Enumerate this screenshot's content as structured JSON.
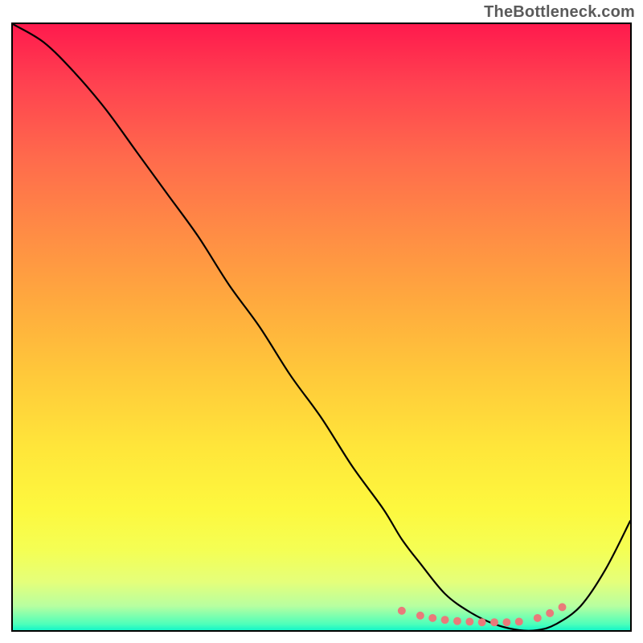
{
  "watermark": "TheBottleneck.com",
  "chart_data": {
    "type": "line",
    "title": "",
    "xlabel": "",
    "ylabel": "",
    "xlim": [
      0,
      100
    ],
    "ylim": [
      0,
      100
    ],
    "gradient_stops": [
      {
        "offset": 0,
        "color": "#ff1a4d"
      },
      {
        "offset": 10,
        "color": "#ff4250"
      },
      {
        "offset": 22,
        "color": "#ff6a4c"
      },
      {
        "offset": 34,
        "color": "#ff8b45"
      },
      {
        "offset": 46,
        "color": "#ffaa3e"
      },
      {
        "offset": 58,
        "color": "#ffc93a"
      },
      {
        "offset": 70,
        "color": "#ffe63a"
      },
      {
        "offset": 80,
        "color": "#fdf83e"
      },
      {
        "offset": 87,
        "color": "#f4ff55"
      },
      {
        "offset": 92,
        "color": "#e5ff7a"
      },
      {
        "offset": 96,
        "color": "#b8ffa0"
      },
      {
        "offset": 99,
        "color": "#4effba"
      },
      {
        "offset": 100,
        "color": "#14f5c8"
      }
    ],
    "series": [
      {
        "name": "bottleneck-curve",
        "color": "#000000",
        "x": [
          0,
          5,
          10,
          15,
          20,
          25,
          30,
          35,
          40,
          45,
          50,
          55,
          60,
          63,
          66,
          70,
          74,
          78,
          82,
          85,
          88,
          92,
          96,
          100
        ],
        "y": [
          100,
          97,
          92,
          86,
          79,
          72,
          65,
          57,
          50,
          42,
          35,
          27,
          20,
          15,
          11,
          6,
          3,
          1,
          0,
          0,
          1,
          4,
          10,
          18
        ]
      }
    ],
    "markers": {
      "name": "flat-region-markers",
      "color": "#e97a7a",
      "radius": 5,
      "points": [
        {
          "x": 63,
          "y": 3.2
        },
        {
          "x": 66,
          "y": 2.4
        },
        {
          "x": 68,
          "y": 2.0
        },
        {
          "x": 70,
          "y": 1.7
        },
        {
          "x": 72,
          "y": 1.5
        },
        {
          "x": 74,
          "y": 1.4
        },
        {
          "x": 76,
          "y": 1.3
        },
        {
          "x": 78,
          "y": 1.3
        },
        {
          "x": 80,
          "y": 1.3
        },
        {
          "x": 82,
          "y": 1.4
        },
        {
          "x": 85,
          "y": 2.0
        },
        {
          "x": 87,
          "y": 2.8
        },
        {
          "x": 89,
          "y": 3.8
        }
      ]
    }
  }
}
